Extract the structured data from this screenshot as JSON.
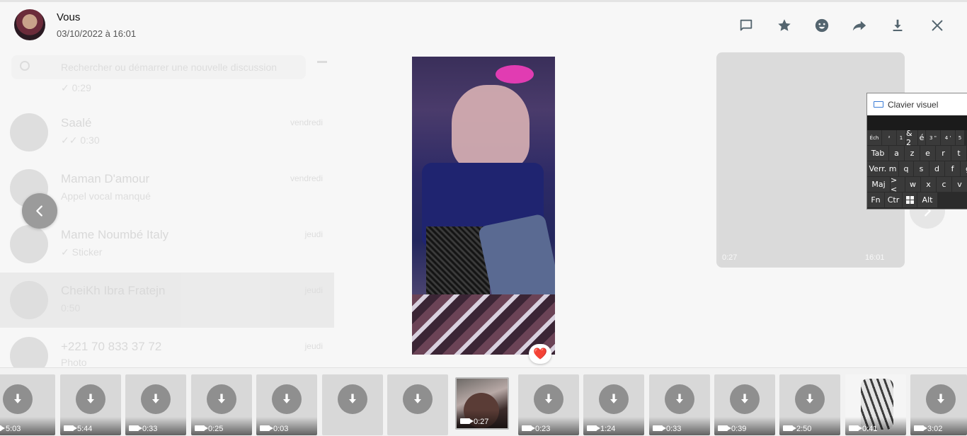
{
  "header": {
    "sender": "Vous",
    "datetime": "03/10/2022 à 16:01"
  },
  "toolbar": {
    "items": [
      "message-icon",
      "star-icon",
      "emoji-icon",
      "forward-icon",
      "download-icon",
      "close-icon"
    ]
  },
  "reaction": "❤️",
  "background": {
    "search_placeholder": "Rechercher ou démarrer une nouvelle discussion",
    "chats": [
      {
        "name": "",
        "preview": "✓ 0:29",
        "time": ""
      },
      {
        "name": "Saalé",
        "preview": "✓✓ 0:30",
        "time": "vendredi"
      },
      {
        "name": "Maman D'amour",
        "preview": "Appel vocal manqué",
        "time": "vendredi"
      },
      {
        "name": "Mame Noumbé Italy",
        "preview": "✓ Sticker",
        "time": "jeudi"
      },
      {
        "name": "CheiKh Ibra Fratejn",
        "preview": "0:50",
        "time": "jeudi"
      },
      {
        "name": "+221 70 833 37 72",
        "preview": "Photo",
        "time": "jeudi"
      }
    ],
    "bubble_duration": "0:27",
    "bubble_time": "16:01"
  },
  "keyboard": {
    "title": "Clavier visuel",
    "rows": [
      [
        "Éch",
        "²",
        "1",
        "& 2",
        "é",
        "3 \"",
        "4 '",
        "5"
      ],
      [
        "Tab",
        "a",
        "z",
        "e",
        "r",
        "t"
      ],
      [
        "Verr. m",
        "q",
        "s",
        "d",
        "f",
        "g"
      ],
      [
        "Maj",
        "> <",
        "w",
        "x",
        "c",
        "v"
      ],
      [
        "Fn",
        "Ctr",
        "win-icon",
        "Alt"
      ]
    ]
  },
  "thumbnails": [
    {
      "duration": "5:03",
      "kind": "download"
    },
    {
      "duration": "5:44",
      "kind": "download"
    },
    {
      "duration": "0:33",
      "kind": "download"
    },
    {
      "duration": "0:25",
      "kind": "download"
    },
    {
      "duration": "0:03",
      "kind": "download"
    },
    {
      "duration": "",
      "kind": "download"
    },
    {
      "duration": "",
      "kind": "download"
    },
    {
      "duration": "0:27",
      "kind": "image",
      "active": true
    },
    {
      "duration": "0:23",
      "kind": "download"
    },
    {
      "duration": "1:24",
      "kind": "download"
    },
    {
      "duration": "0:33",
      "kind": "download"
    },
    {
      "duration": "0:39",
      "kind": "download"
    },
    {
      "duration": "2:50",
      "kind": "download"
    },
    {
      "duration": "0:41",
      "kind": "image"
    },
    {
      "duration": "3:02",
      "kind": "download"
    }
  ]
}
